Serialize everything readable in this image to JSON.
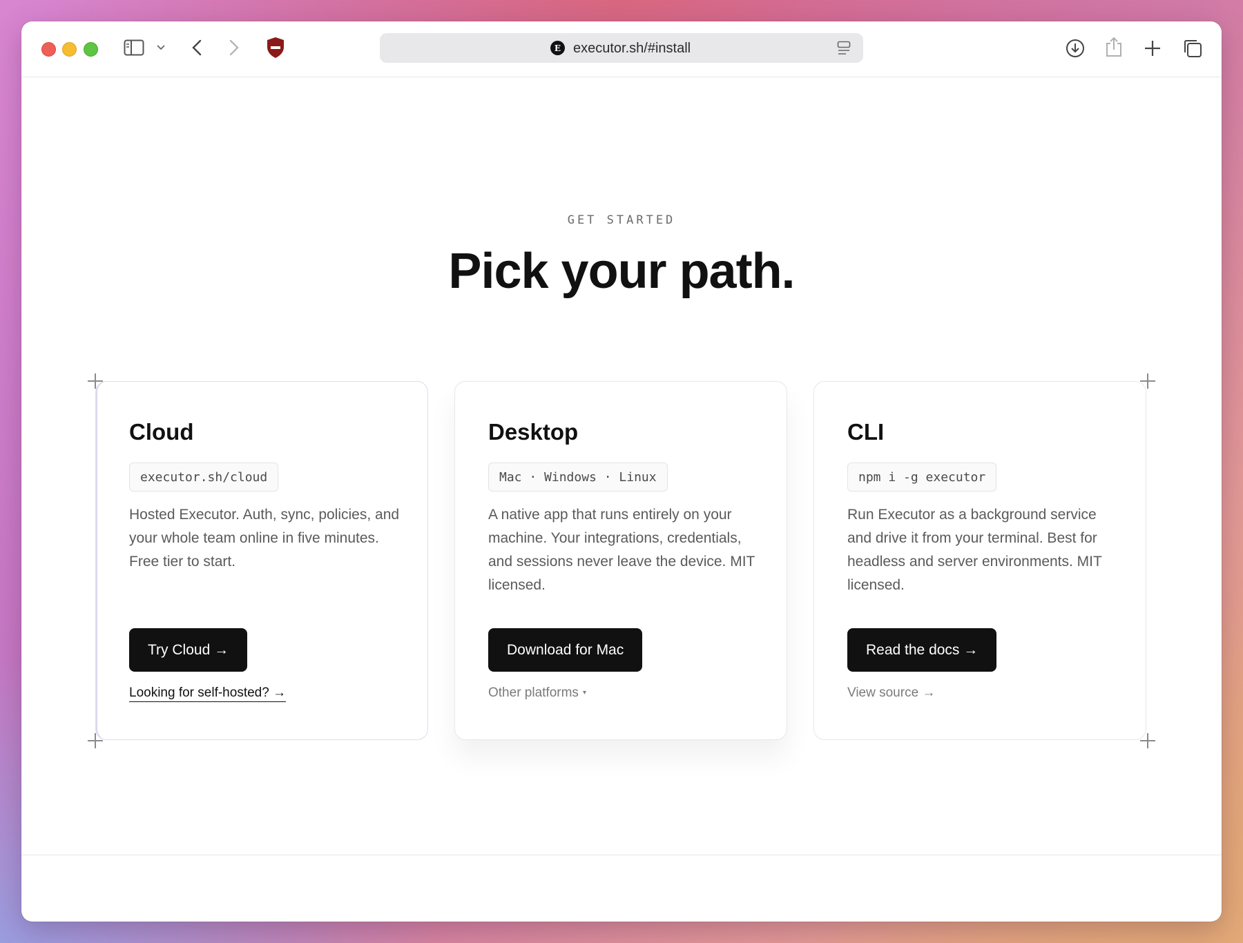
{
  "browser": {
    "url": "executor.sh/#install",
    "favicon_letter": "E",
    "icons": [
      "sidebar-icon",
      "chevron-down-icon",
      "back-icon",
      "forward-icon",
      "shield-icon",
      "reader-icon",
      "download-icon",
      "share-icon",
      "new-tab-icon",
      "tab-overview-icon"
    ]
  },
  "hero": {
    "eyebrow": "GET STARTED",
    "title": "Pick your path."
  },
  "cards": [
    {
      "title": "Cloud",
      "chip": "executor.sh/cloud",
      "description": "Hosted Executor. Auth, sync, policies, and your whole team online in five minutes. Free tier to start.",
      "button": "Try Cloud →",
      "link": "Looking for self-hosted? →"
    },
    {
      "title": "Desktop",
      "chip": "Mac · Windows · Linux",
      "description": "A native app that runs entirely on your machine. Your integrations, credentials, and sessions never leave the device. MIT licensed.",
      "button": "Download for Mac",
      "link": "Other platforms",
      "link_caret": "▾"
    },
    {
      "title": "CLI",
      "chip": "npm i -g executor",
      "description": "Run Executor as a background service and drive it from your terminal. Best for headless and server environments. MIT licensed.",
      "button": "Read the docs →",
      "link": "View source →"
    }
  ],
  "colors": {
    "accent": "#111111",
    "shield": "#8b1a1a",
    "muted_text": "#5a5a5a"
  }
}
